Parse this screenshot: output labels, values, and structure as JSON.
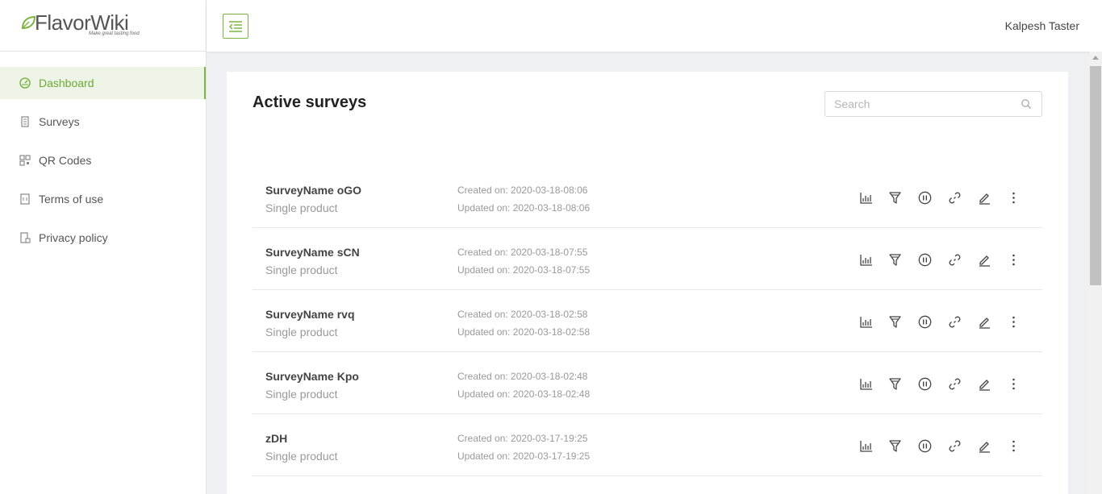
{
  "app": {
    "logo_text": "FlavorWiki",
    "logo_tagline": "Make great tasting food",
    "menu_toggle": "menu-toggle",
    "user_name": "Kalpesh Taster"
  },
  "sidebar": {
    "items": [
      {
        "label": "Dashboard",
        "icon": "dashboard-icon",
        "active": true
      },
      {
        "label": "Surveys",
        "icon": "survey-icon",
        "active": false
      },
      {
        "label": "QR Codes",
        "icon": "qr-code-icon",
        "active": false
      },
      {
        "label": "Terms of use",
        "icon": "terms-icon",
        "active": false
      },
      {
        "label": "Privacy policy",
        "icon": "privacy-icon",
        "active": false
      }
    ]
  },
  "main": {
    "title": "Active surveys",
    "search_placeholder": "Search",
    "surveys": [
      {
        "name": "SurveyName oGO",
        "type": "Single product",
        "created": "Created on: 2020-03-18-08:06",
        "updated": "Updated on: 2020-03-18-08:06"
      },
      {
        "name": "SurveyName sCN",
        "type": "Single product",
        "created": "Created on: 2020-03-18-07:55",
        "updated": "Updated on: 2020-03-18-07:55"
      },
      {
        "name": "SurveyName rvq",
        "type": "Single product",
        "created": "Created on: 2020-03-18-02:58",
        "updated": "Updated on: 2020-03-18-02:58"
      },
      {
        "name": "SurveyName Kpo",
        "type": "Single product",
        "created": "Created on: 2020-03-18-02:48",
        "updated": "Updated on: 2020-03-18-02:48"
      },
      {
        "name": "zDH",
        "type": "Single product",
        "created": "Created on: 2020-03-17-19:25",
        "updated": "Updated on: 2020-03-17-19:25"
      }
    ],
    "row_actions": [
      "stats-icon",
      "funnel-icon",
      "pause-icon",
      "link-icon",
      "edit-icon",
      "more-icon"
    ]
  },
  "colors": {
    "accent": "#7db542",
    "active_bg": "#eef5e6",
    "muted_text": "#999999"
  }
}
